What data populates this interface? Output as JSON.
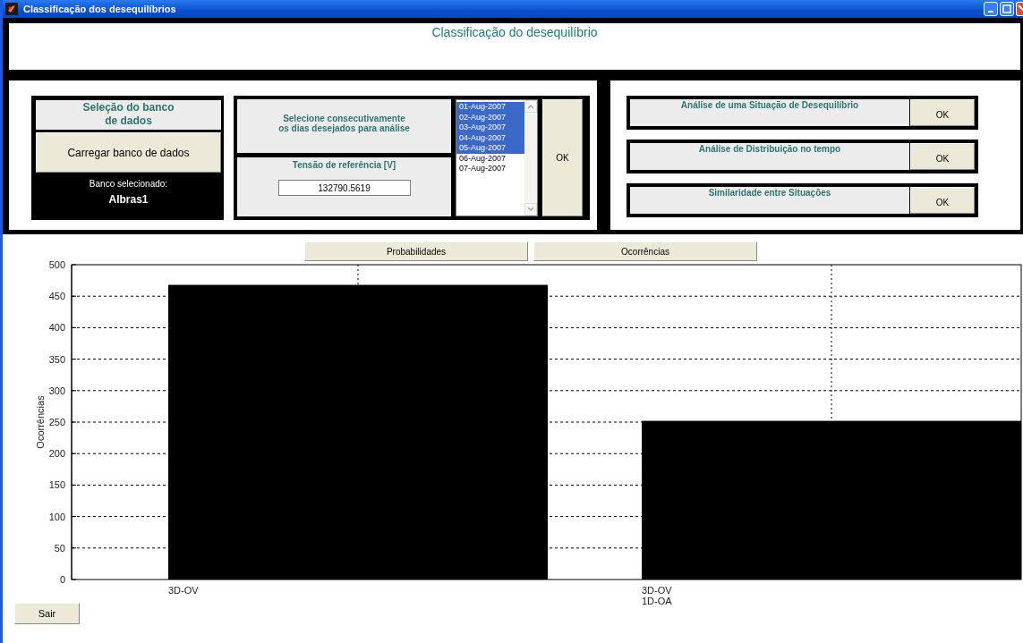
{
  "window": {
    "title": "Classificação dos desequilíbrios"
  },
  "header": {
    "title": "Classificação do desequilíbrio"
  },
  "database": {
    "title": "Seleção do banco\nde dados",
    "load_button": "Carregar banco de dados",
    "selected_label": "Banco selecionado:",
    "selected_value": "Albras1"
  },
  "days": {
    "instruction": "Selecione consecutivamente\nos dias desejados para análise",
    "reference_label": "Tensão de referência [V]",
    "reference_value": "132790.5619",
    "ok_button": "OK",
    "dates": [
      {
        "label": "01-Aug-2007",
        "selected": true
      },
      {
        "label": "02-Aug-2007",
        "selected": true
      },
      {
        "label": "03-Aug-2007",
        "selected": true
      },
      {
        "label": "04-Aug-2007",
        "selected": true
      },
      {
        "label": "05-Aug-2007",
        "selected": true
      },
      {
        "label": "06-Aug-2007",
        "selected": false
      },
      {
        "label": "07-Aug-2007",
        "selected": false
      }
    ]
  },
  "analyses": [
    {
      "label": "Análise de uma Situação de Desequilíbrio",
      "button": "OK"
    },
    {
      "label": "Análise de Distribuição no tempo",
      "button": "OK"
    },
    {
      "label": "Similaridade entre Situações",
      "button": "OK"
    }
  ],
  "chart_buttons": [
    "Probabilidades",
    "Ocorrências"
  ],
  "chart_data": {
    "type": "bar",
    "ylabel": "Ocorrências",
    "categories": [
      "3D-OV",
      "3D-OV\n1D-OA"
    ],
    "values": [
      468,
      252
    ],
    "grid": true,
    "ylim": [
      0,
      500
    ],
    "yticks": [
      0,
      50,
      100,
      150,
      200,
      250,
      300,
      350,
      400,
      450,
      500
    ]
  },
  "exit_button": "Sair"
}
